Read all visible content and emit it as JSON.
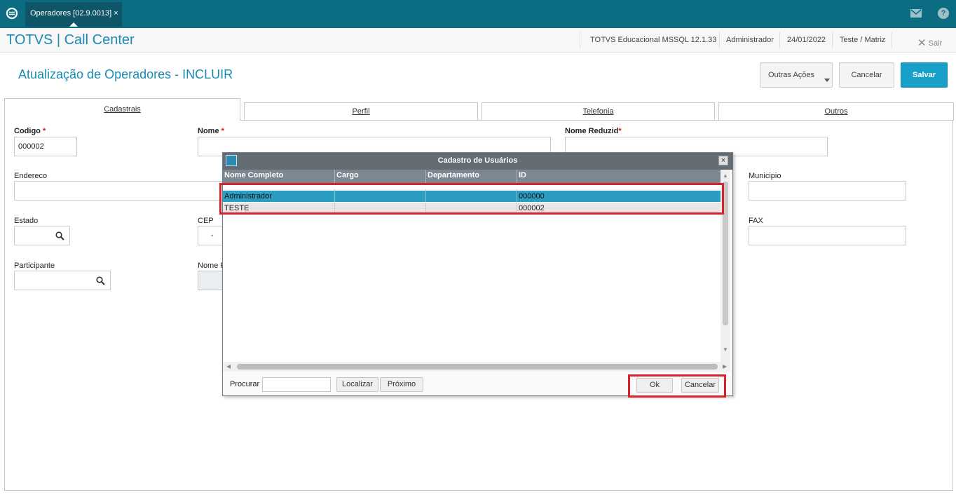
{
  "topbar": {
    "tab_label": "Operadores [02.9.0013]",
    "tab_close": "×"
  },
  "header": {
    "app_title": "TOTVS | Call Center",
    "environment": "TOTVS Educacional MSSQL 12.1.33",
    "user": "Administrador",
    "date": "24/01/2022",
    "branch": "Teste / Matriz",
    "exit_label": "Sair"
  },
  "page": {
    "title": "Atualização de Operadores - INCLUIR",
    "actions": {
      "more": "Outras Ações",
      "cancel": "Cancelar",
      "save": "Salvar"
    }
  },
  "folders": [
    "Cadastrais",
    "Perfil",
    "Telefonia",
    "Outros"
  ],
  "form": {
    "codigo_label": "Codigo",
    "codigo_value": "000002",
    "nome_label": "Nome",
    "nome_reduzido_label": "Nome Reduzid",
    "required_mark": "*",
    "endereco_label": "Endereco",
    "municipio_label": "Municipio",
    "estado_label": "Estado",
    "cep_label": "CEP",
    "cep_value": "-",
    "fax_label": "FAX",
    "participante_label": "Participante",
    "nome_part_label": "Nome P"
  },
  "dialog": {
    "title": "Cadastro de Usuários",
    "close": "×",
    "columns": [
      "Nome Completo",
      "Cargo",
      "Departamento",
      "ID"
    ],
    "rows": [
      {
        "nome": "Administrador",
        "cargo": "",
        "departamento": "",
        "id": "000000",
        "selected": true
      },
      {
        "nome": "TESTE",
        "cargo": "",
        "departamento": "",
        "id": "000002",
        "selected": false
      }
    ],
    "search_label": "Procurar",
    "search_value": "",
    "locate_button": "Localizar",
    "next_button": "Próximo",
    "ok_button": "Ok",
    "cancel_button": "Cancelar"
  },
  "colors": {
    "topbar": "#0b6c82",
    "accent": "#1b8bb2",
    "selected_row": "#2b9dc3",
    "highlight_box": "#d9202d"
  }
}
